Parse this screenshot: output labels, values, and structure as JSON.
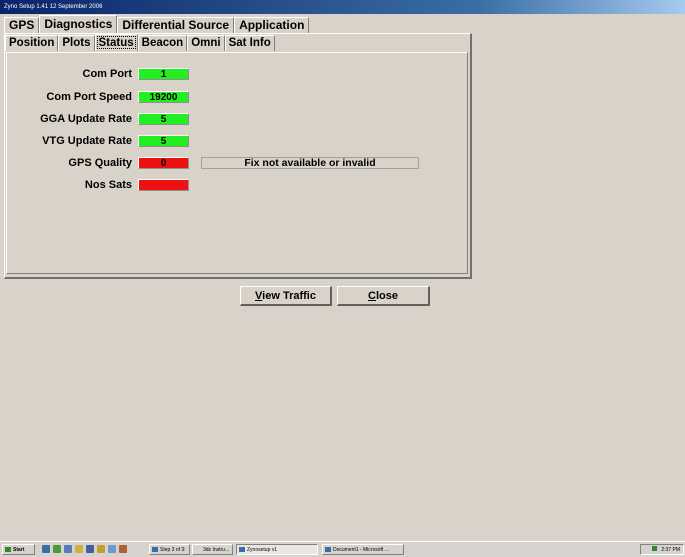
{
  "window": {
    "title": "Zyno Setup 1.41 12 September 2006"
  },
  "main_tabs": [
    {
      "label": "GPS",
      "active": false
    },
    {
      "label": "Diagnostics",
      "active": true
    },
    {
      "label": "Differential Source",
      "active": false
    },
    {
      "label": "Application",
      "active": false
    }
  ],
  "sub_tabs": [
    {
      "label": "Position",
      "active": false
    },
    {
      "label": "Plots",
      "active": false
    },
    {
      "label": "Status",
      "active": true
    },
    {
      "label": "Beacon",
      "active": false
    },
    {
      "label": "Omni",
      "active": false
    },
    {
      "label": "Sat Info",
      "active": false
    }
  ],
  "status_rows": [
    {
      "label": "Com Port",
      "value": "1",
      "color": "#22ee22"
    },
    {
      "label": "Com Port Speed",
      "value": "19200",
      "color": "#22ee22"
    },
    {
      "label": "GGA Update Rate",
      "value": "5",
      "color": "#22ee22"
    },
    {
      "label": "VTG Update Rate",
      "value": "5",
      "color": "#22ee22"
    },
    {
      "label": "GPS Quality",
      "value": "0",
      "color": "#ee1111",
      "message": "Fix not available or invalid"
    },
    {
      "label": "Nos Sats",
      "value": "",
      "color": "#ee1111"
    }
  ],
  "buttons": {
    "view_traffic": {
      "mnemonic": "V",
      "rest": "iew Traffic"
    },
    "close": {
      "mnemonic": "C",
      "rest": "lose"
    }
  },
  "taskbar": {
    "start_label": "Start",
    "items": [
      {
        "label": "Step 3 of 3:"
      },
      {
        "label": "3ds Instru..."
      },
      {
        "label": "Zynosetup v1",
        "active": true
      },
      {
        "label": "Document1 - Microsoft ..."
      }
    ],
    "clock": "2:37 PM"
  }
}
